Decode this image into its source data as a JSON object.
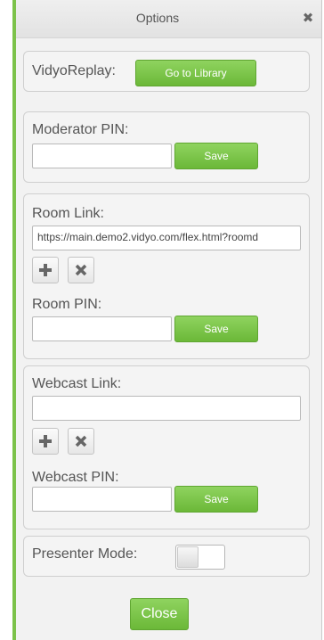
{
  "dialog": {
    "title": "Options",
    "close_glyph": "✖"
  },
  "vidyo_replay": {
    "label": "VidyoReplay:",
    "button_label": "Go to Library"
  },
  "moderator": {
    "label": "Moderator PIN:",
    "pin_value": "",
    "save_label": "Save"
  },
  "room": {
    "link_label": "Room Link:",
    "link_value": "https://main.demo2.vidyo.com/flex.html?roomd",
    "add_icon": "plus-icon",
    "remove_icon": "x-icon",
    "pin_label": "Room PIN:",
    "pin_value": "",
    "save_label": "Save"
  },
  "webcast": {
    "link_label": "Webcast Link:",
    "link_value": "",
    "add_icon": "plus-icon",
    "remove_icon": "x-icon",
    "pin_label": "Webcast PIN:",
    "pin_value": "",
    "save_label": "Save"
  },
  "presenter": {
    "label": "Presenter Mode:",
    "enabled": false
  },
  "footer": {
    "close_label": "Close"
  },
  "colors": {
    "accent_green": "#7cc24a",
    "button_green": "#6bb838",
    "panel_bg": "#f4f4f4",
    "text": "#555555"
  }
}
